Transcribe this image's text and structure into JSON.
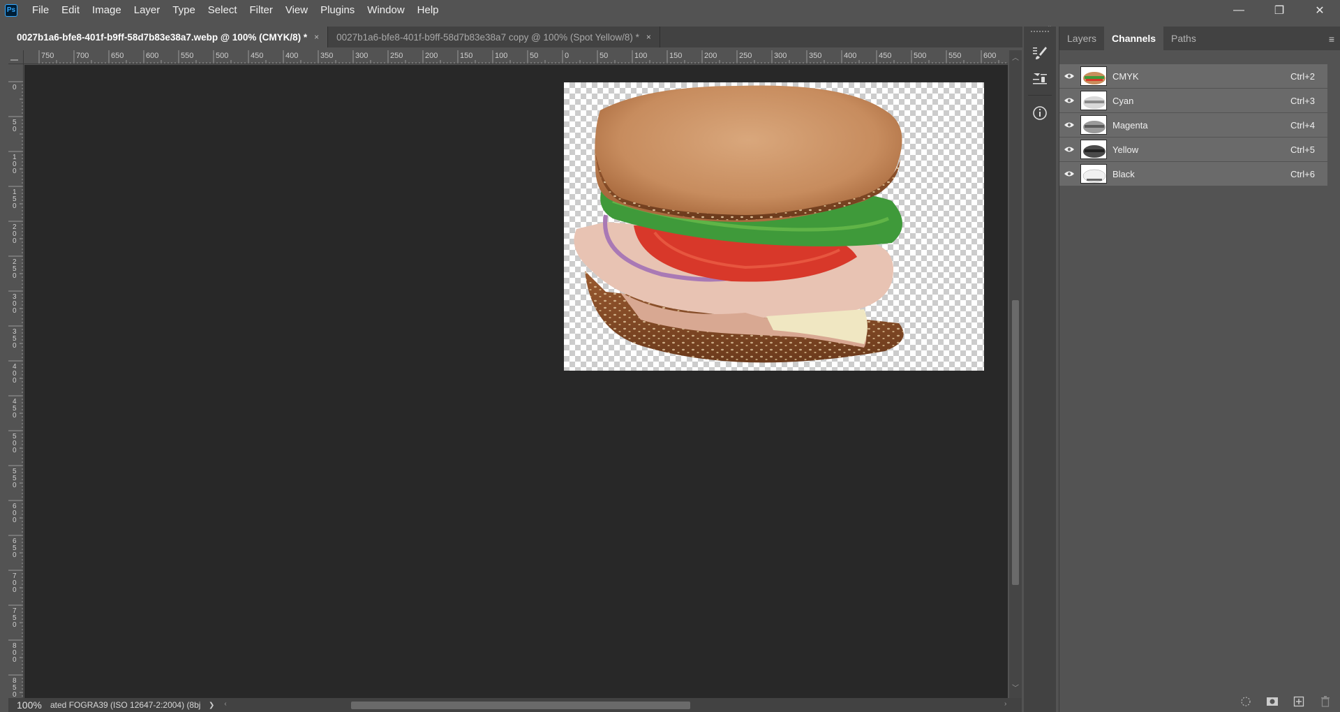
{
  "app": {
    "logo_text": "Ps"
  },
  "menu": [
    "File",
    "Edit",
    "Image",
    "Layer",
    "Type",
    "Select",
    "Filter",
    "View",
    "Plugins",
    "Window",
    "Help"
  ],
  "window_controls": {
    "minimize": "—",
    "restore": "❐",
    "close": "✕"
  },
  "tabs": [
    {
      "label": "0027b1a6-bfe8-401f-b9ff-58d7b83e38a7.webp @ 100% (CMYK/8) *",
      "active": true
    },
    {
      "label": "0027b1a6-bfe8-401f-b9ff-58d7b83e38a7 copy @ 100% (Spot Yellow/8) *",
      "active": false
    }
  ],
  "tab_close_glyph": "×",
  "ruler": {
    "h_labels": [
      "750",
      "700",
      "650",
      "600",
      "550",
      "500",
      "450",
      "400",
      "350",
      "300",
      "250",
      "200",
      "150",
      "100",
      "50",
      "0",
      "50",
      "100",
      "150",
      "200",
      "250",
      "300",
      "350",
      "400",
      "450",
      "500",
      "550",
      "600"
    ],
    "v_labels": [
      "0",
      "50",
      "100",
      "150",
      "200",
      "250",
      "300",
      "350",
      "400",
      "450",
      "500",
      "550",
      "600",
      "650",
      "700",
      "750",
      "800",
      "850"
    ]
  },
  "panel": {
    "tabs": [
      "Layers",
      "Channels",
      "Paths"
    ],
    "active_tab": "Channels",
    "channels": [
      {
        "name": "CMYK",
        "shortcut": "Ctrl+2",
        "thumb": "color"
      },
      {
        "name": "Cyan",
        "shortcut": "Ctrl+3",
        "thumb": "gray-light"
      },
      {
        "name": "Magenta",
        "shortcut": "Ctrl+4",
        "thumb": "gray-mid"
      },
      {
        "name": "Yellow",
        "shortcut": "Ctrl+5",
        "thumb": "gray-dark"
      },
      {
        "name": "Black",
        "shortcut": "Ctrl+6",
        "thumb": "gray-faint"
      }
    ]
  },
  "status": {
    "zoom": "100%",
    "profile": "ated FOGRA39 (ISO 12647-2:2004) (8bj",
    "profile_arrow": "❯"
  },
  "colors": {
    "accent": "#31a8ff",
    "canvas_bg": "#282828",
    "ui_bg": "#535353"
  },
  "icons": [
    "brush-settings-icon",
    "adjustments-icon",
    "info-icon",
    "eye-icon",
    "load-selection-icon",
    "save-selection-icon",
    "new-channel-icon",
    "trash-icon",
    "panel-menu-icon"
  ]
}
